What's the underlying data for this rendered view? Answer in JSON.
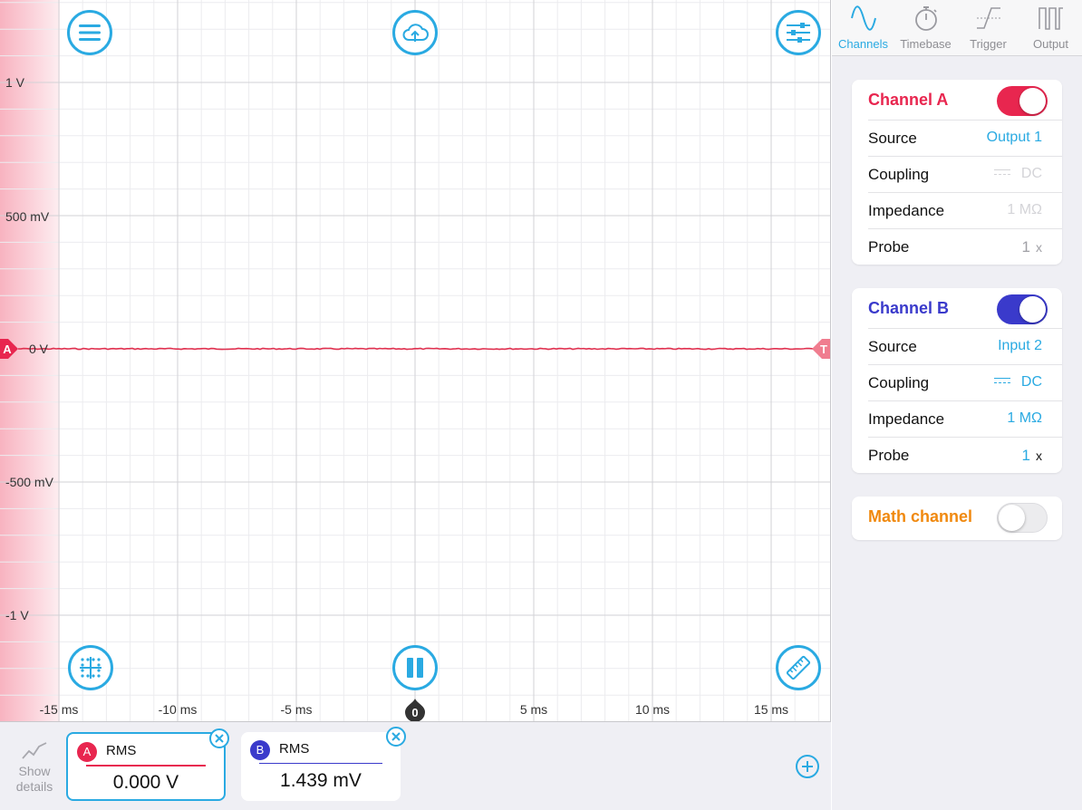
{
  "colors": {
    "accent": "#2aaae2",
    "channel_a": "#e8264f",
    "channel_b": "#3a3acb",
    "math": "#f0890f",
    "trace_a": "#e0304f"
  },
  "scope": {
    "voltage_labels": [
      "1 V",
      "500 mV",
      "0 V",
      "-500 mV",
      "-1 V"
    ],
    "time_labels": [
      "-15 ms",
      "-10 ms",
      "-5 ms",
      "5 ms",
      "10 ms",
      "15 ms"
    ],
    "time_zero_label": "0",
    "marker_a": "A",
    "marker_t": "T",
    "buttons": {
      "menu": "menu-icon",
      "upload": "cloud-upload-icon",
      "settings": "sliders-icon",
      "grid": "grid-icon",
      "pause": "pause-icon",
      "measure": "ruler-icon"
    }
  },
  "measurements": {
    "show_details": "Show details",
    "cards": [
      {
        "badge": "A",
        "name": "RMS",
        "value": "0.000 V"
      },
      {
        "badge": "B",
        "name": "RMS",
        "value": "1.439 mV"
      }
    ]
  },
  "tabs": [
    {
      "label": "Channels",
      "icon": "sine-wave-icon",
      "active": true
    },
    {
      "label": "Timebase",
      "icon": "stopwatch-icon",
      "active": false
    },
    {
      "label": "Trigger",
      "icon": "trigger-edge-icon",
      "active": false
    },
    {
      "label": "Output",
      "icon": "pulse-wave-icon",
      "active": false
    }
  ],
  "channel_a": {
    "title": "Channel A",
    "enabled": true,
    "rows": [
      {
        "label": "Source",
        "value": "Output 1"
      },
      {
        "label": "Coupling",
        "value": "DC"
      },
      {
        "label": "Impedance",
        "value": "1 MΩ"
      },
      {
        "label": "Probe",
        "value": "1",
        "unit": "x"
      }
    ]
  },
  "channel_b": {
    "title": "Channel B",
    "enabled": true,
    "rows": [
      {
        "label": "Source",
        "value": "Input 2"
      },
      {
        "label": "Coupling",
        "value": "DC"
      },
      {
        "label": "Impedance",
        "value": "1 MΩ"
      },
      {
        "label": "Probe",
        "value": "1",
        "unit": "x"
      }
    ]
  },
  "math_channel": {
    "title": "Math channel",
    "enabled": false
  }
}
